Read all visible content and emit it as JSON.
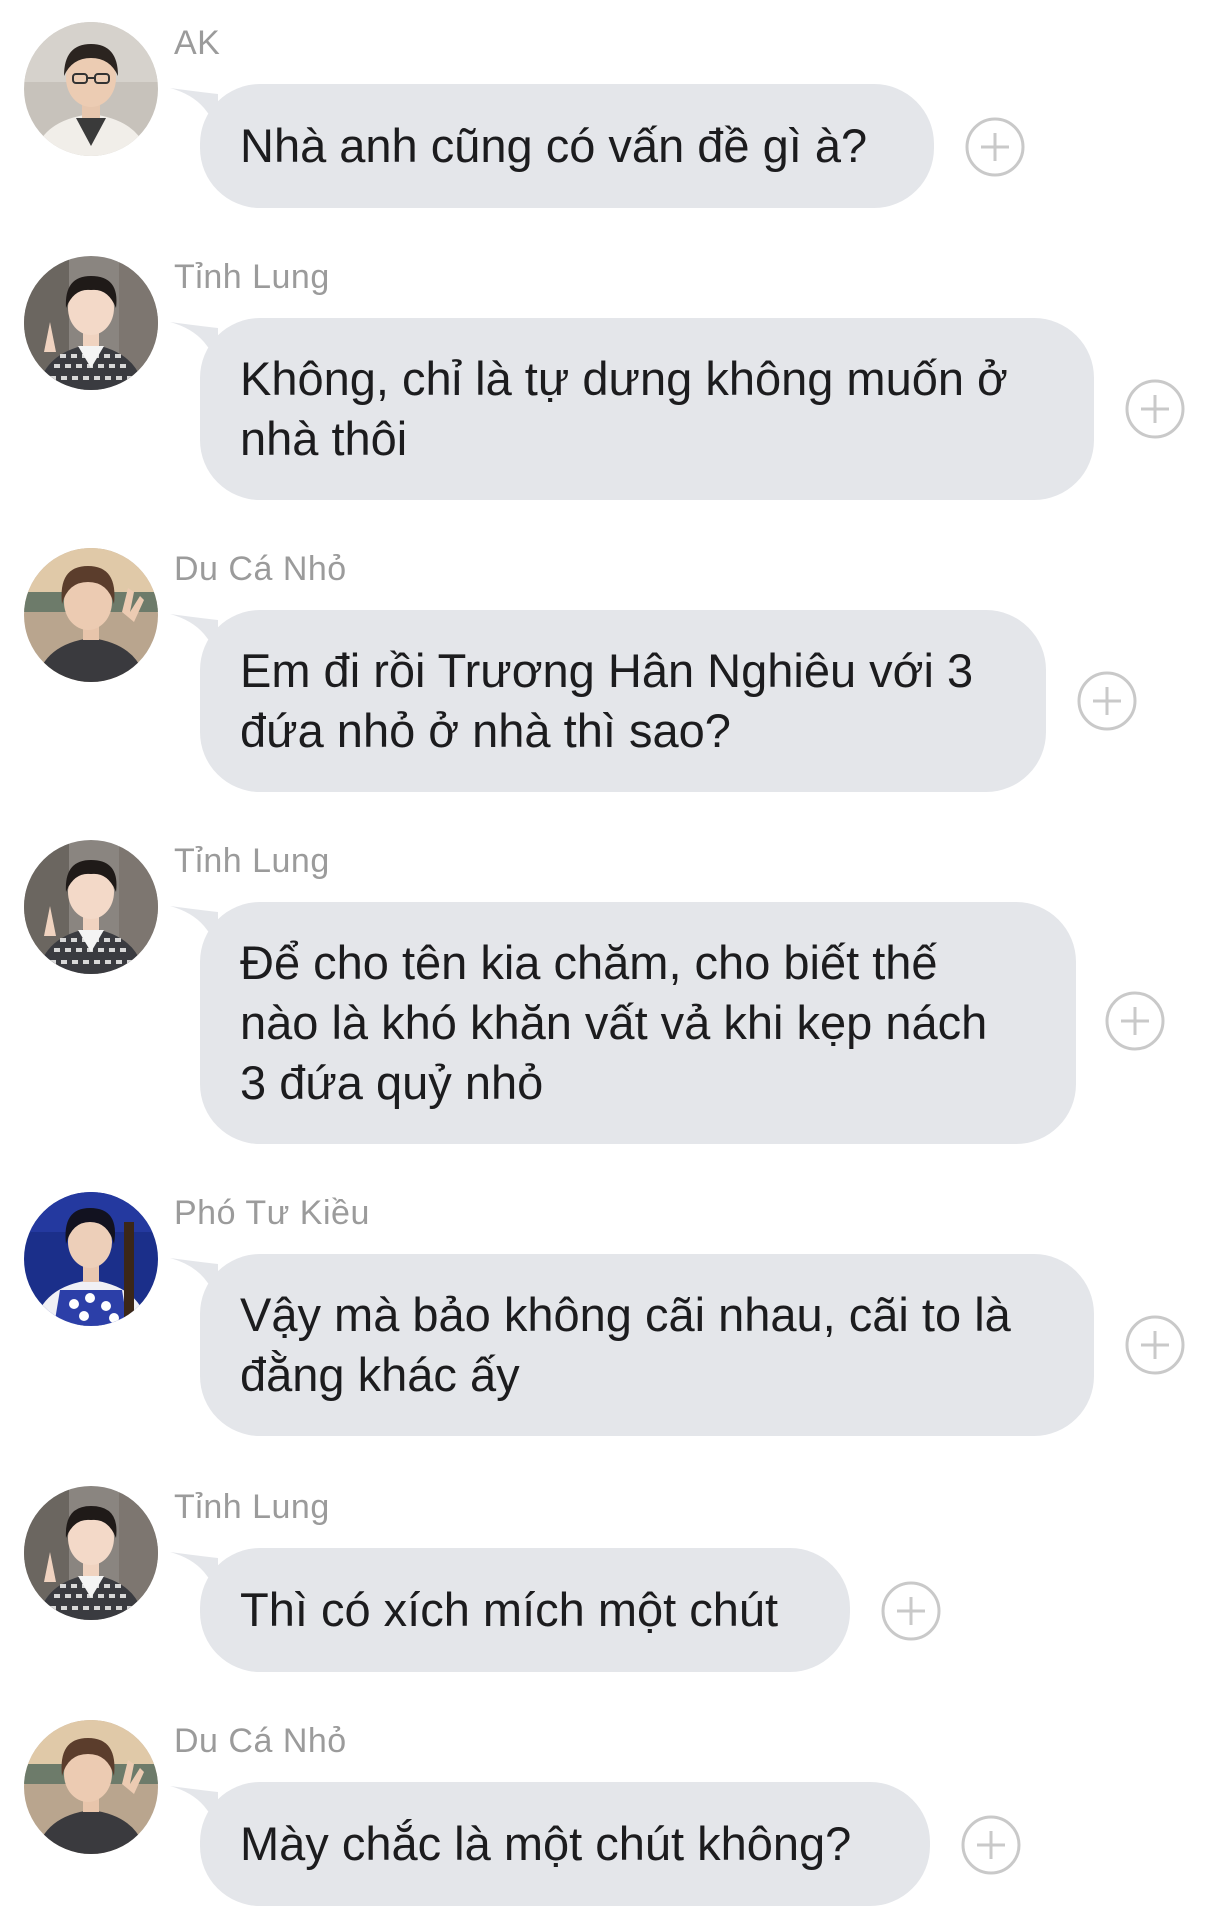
{
  "conversation": {
    "messages": [
      {
        "sender": "AK",
        "text": "Nhà anh cũng có vấn đề gì à?",
        "avatar_icon": "ak-profile-avatar"
      },
      {
        "sender": "Tỉnh Lung",
        "text": "Không, chỉ là tự dưng không muốn ở\nnhà thôi",
        "avatar_icon": "tinh-lung-profile-avatar"
      },
      {
        "sender": "Du Cá Nhỏ",
        "text": "Em đi rồi Trương Hân Nghiêu với 3\nđứa nhỏ ở nhà thì sao?",
        "avatar_icon": "du-ca-nho-profile-avatar"
      },
      {
        "sender": "Tỉnh Lung",
        "text": "Để cho tên kia chăm, cho biết thế\nnào là khó khăn vất vả khi kẹp nách\n3 đứa quỷ nhỏ",
        "avatar_icon": "tinh-lung-profile-avatar"
      },
      {
        "sender": "Phó Tư Kiều",
        "text": "Vậy mà bảo không cãi nhau, cãi to là\nđằng khác ấy",
        "avatar_icon": "pho-tu-kieu-profile-avatar"
      },
      {
        "sender": "Tỉnh Lung",
        "text": "Thì có xích mích một chút",
        "avatar_icon": "tinh-lung-profile-avatar"
      },
      {
        "sender": "Du Cá Nhỏ",
        "text": "Mày chắc là một chút không?",
        "avatar_icon": "du-ca-nho-profile-avatar"
      }
    ]
  },
  "icons": {
    "reaction": "add-reaction-icon"
  },
  "colors": {
    "bubble": "#e4e6ea",
    "sender_name": "#9b9b9b",
    "message_text": "#1c1c1e",
    "reaction_icon": "#c9c9c9",
    "background": "#ffffff"
  }
}
